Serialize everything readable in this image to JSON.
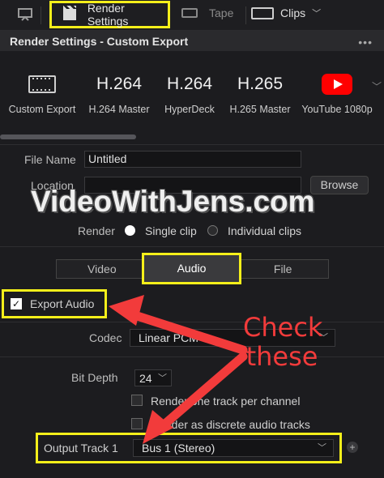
{
  "toolbar": {
    "render_settings": "Render Settings",
    "tape": "Tape",
    "clips": "Clips"
  },
  "panel": {
    "title": "Render Settings - Custom Export",
    "menu": "•••"
  },
  "presets": [
    {
      "big": "",
      "label": "Custom Export",
      "icon": "film-icon"
    },
    {
      "big": "H.264",
      "label": "H.264 Master"
    },
    {
      "big": "H.264",
      "label": "HyperDeck"
    },
    {
      "big": "H.265",
      "label": "H.265 Master"
    },
    {
      "big": "",
      "label": "YouTube 1080p",
      "icon": "youtube-icon"
    }
  ],
  "form": {
    "file_name_label": "File Name",
    "file_name_value": "Untitled",
    "location_label": "Location",
    "location_value": "",
    "browse": "Browse",
    "render_label": "Render",
    "single_clip": "Single clip",
    "individual_clips": "Individual clips"
  },
  "tabs": {
    "video": "Video",
    "audio": "Audio",
    "file": "File"
  },
  "audio": {
    "export_audio": "Export Audio",
    "codec_label": "Codec",
    "codec_value": "Linear PCM",
    "bit_depth_label": "Bit Depth",
    "bit_depth_value": "24",
    "render_one_track": "Render one track per channel",
    "render_discrete": "Render as discrete audio tracks",
    "output_track_label": "Output Track 1",
    "output_track_value": "Bus 1 (Stereo)"
  },
  "overlay": {
    "watermark": "VideoWithJens.com",
    "annotation_line1": "Check",
    "annotation_line2": "these"
  },
  "colors": {
    "highlight": "#f5ef1a",
    "arrow": "#f23b3b",
    "youtube": "#ff0000"
  }
}
